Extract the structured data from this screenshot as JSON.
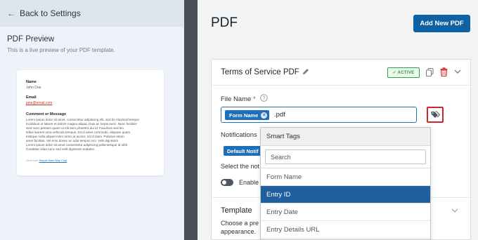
{
  "left_panel": {
    "back_label": "Back to Settings",
    "preview_title": "PDF Preview",
    "preview_subtitle": "This is a live preview of your PDF template.",
    "preview": {
      "name_label": "Name",
      "name_value": "John Doe",
      "email_label": "Email",
      "email_value": "jane@email.com",
      "message_label": "Comment or Message",
      "message_lines": [
        "Lorem ipsum dolor sit amet, consectetur adipiscing elit, sed do eiusmod tempor",
        "incididunt ut labore et dolore magna aliqua. Duis ac turpis nunc. Nunc facilisis",
        "Sed nunc pretium quam ut elit sem pharetra dui id. Faucibus sed leo",
        "tellus laoreet urna vehicula tempus. Sit id amet commodo, aliquam quam",
        "tristique nulla aliquet enim tortor at auctor. Sit id diam. Pulvinar etiam",
        "amet facilisis. Vel eros donec ac odio tempor orci. Velit dignissim",
        "Lorem ipsum dolor sit amet consectetur adipiscing pellentesque id nibh",
        "Curabitur vitae nunc sed velit dignissim sodales."
      ],
      "footer_prefix": "Sent from",
      "footer_link": "Simple New Way Club"
    }
  },
  "right_panel": {
    "page_title": "PDF",
    "add_button": "Add New PDF",
    "card": {
      "title": "Terms of Service PDF",
      "badge": "✓ ACTIVE",
      "file_name_label": "File Name",
      "required_mark": "*",
      "tag_chip": "Form Name",
      "file_ext": ".pdf",
      "notifications_label": "Notifications",
      "notification_chip": "Default Notif",
      "select_note": "Select the not",
      "enable_label": "Enable",
      "template_label": "Template",
      "template_desc_1": "Choose a pre",
      "template_desc_2": "appearance."
    }
  },
  "smart_tags": {
    "header": "Smart Tags",
    "search_placeholder": "Search",
    "items": [
      {
        "label": "Form Name",
        "selected": false
      },
      {
        "label": "Entry ID",
        "selected": true
      },
      {
        "label": "Entry Date",
        "selected": false
      },
      {
        "label": "Entry Details URL",
        "selected": false
      }
    ]
  },
  "colors": {
    "primary": "#0e62a3",
    "selected_item": "#1f5f9e",
    "active_green": "#2e9e47",
    "highlight_red": "#d1232a",
    "delete_red": "#d63638"
  },
  "icons": [
    "arrow-left-icon",
    "edit-pencil-icon",
    "copy-icon",
    "trash-icon",
    "chevron-down-icon",
    "help-icon",
    "tag-icon",
    "close-icon"
  ]
}
